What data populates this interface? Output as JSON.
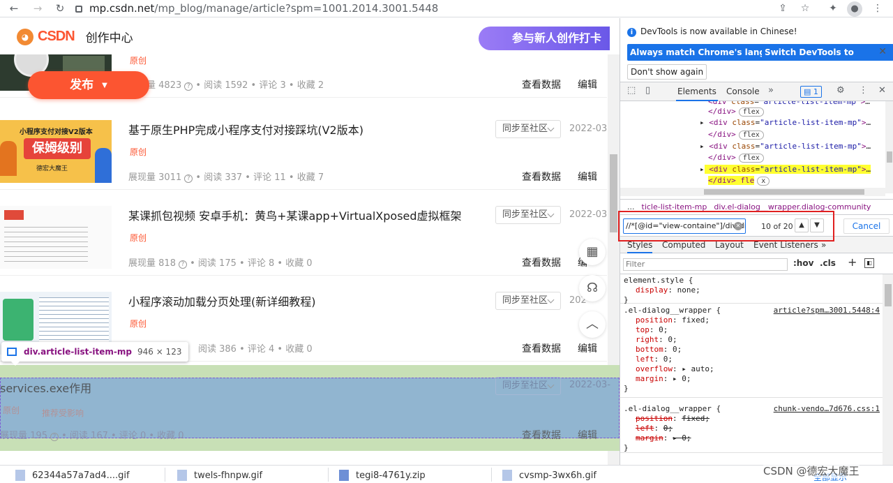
{
  "browser": {
    "url_host": "mp.csdn.net",
    "url_path": "/mp_blog/manage/article?spm=1001.2014.3001.5448"
  },
  "header": {
    "logo_text": "CSDN",
    "subtitle": "创作中心",
    "banner_text": "参与新人创作打卡",
    "publish_label": "发布"
  },
  "articles": [
    {
      "title": "",
      "tag": "原创",
      "impressions_label": "展现量",
      "impressions": "4823",
      "reads": "阅读 1592",
      "comments": "评论 3",
      "favs": "收藏 2",
      "view_data": "查看数据",
      "edit": "编辑"
    },
    {
      "title": "基于原生PHP完成小程序支付对接踩坑(V2版本)",
      "tag": "原创",
      "impressions_label": "展现量",
      "impressions": "3011",
      "reads": "阅读 337",
      "comments": "评论 11",
      "favs": "收藏 7",
      "sync": "同步至社区",
      "date": "2022-03-",
      "view_data": "查看数据",
      "edit": "编辑"
    },
    {
      "title": "某课抓包视频 安卓手机：黄鸟+某课app+VirtualXposed虚拟框架",
      "tag": "原创",
      "impressions_label": "展现量",
      "impressions": "818",
      "reads": "阅读 175",
      "comments": "评论 8",
      "favs": "收藏 0",
      "sync": "同步至社区",
      "date": "2022-03-",
      "view_data": "查看数据",
      "edit": "编"
    },
    {
      "title": "小程序滚动加载分页处理(新详细教程)",
      "tag": "原创",
      "impressions_label": "",
      "impressions": "",
      "reads": "阅读 386",
      "comments": "评论 4",
      "favs": "收藏 0",
      "sync": "同步至社区",
      "date": "202",
      "view_data": "查看数据",
      "edit": "编辑"
    },
    {
      "title": "services.exe作用",
      "tag": "原创",
      "tag2": "推荐受影响",
      "impressions_label": "展现量",
      "impressions": "195",
      "reads": "阅读 167",
      "comments": "评论 0",
      "favs": "收藏 0",
      "sync": "同步至社区",
      "date": "2022-03-",
      "view_data": "查看数据",
      "edit": "编辑"
    }
  ],
  "thumbs": {
    "t1_line1": "小程序支付对接V2版本",
    "t1_line2": "保姆级别",
    "t1_line3": "德宏大魔王"
  },
  "tooltip": {
    "name": "div.article-list-item-mp",
    "dims": "946 × 123"
  },
  "devtools": {
    "info_msg": "DevTools is now available in Chinese!",
    "btn_match": "Always match Chrome's language",
    "btn_switch": "Switch DevTools to Chinese",
    "btn_dont": "Don't show again",
    "tab_elements": "Elements",
    "tab_console": "Console",
    "issues_count": "1",
    "dom_lines": [
      {
        "text": "class=\"article-list-item-mp\">…",
        "kind": "open"
      },
      {
        "text": "</div>",
        "pill": "flex"
      },
      {
        "text": "<div class=\"article-list-item-mp\">…",
        "kind": "open"
      },
      {
        "text": "</div>",
        "pill": "flex"
      },
      {
        "text": "<div class=\"article-list-item-mp\">…",
        "kind": "open"
      },
      {
        "text": "</div>",
        "pill": "flex"
      },
      {
        "text": "<div class=\"article-list-item-mp\">…",
        "kind": "open"
      },
      {
        "text": "</div>",
        "pill": "fle"
      }
    ],
    "crumbs": [
      "...",
      "ticle-list-item-mp",
      "div.el-dialog__wrapper.dialog-community"
    ],
    "search_value": "//*[@id=\"view-containe\"]/div/di",
    "search_count": "10 of 20",
    "cancel": "Cancel",
    "style_tabs": [
      "Styles",
      "Computed",
      "Layout",
      "Event Listeners"
    ],
    "filter_placeholder": "Filter",
    "hov": ":hov",
    "cls": ".cls",
    "rules": [
      {
        "selector": "element.style {",
        "source": "",
        "props": [
          [
            "display",
            "none;"
          ]
        ]
      },
      {
        "selector": ".el-dialog__wrapper {",
        "source": "article?spm…3001.5448:4",
        "props": [
          [
            "position",
            "fixed;"
          ],
          [
            "top",
            "0;"
          ],
          [
            "right",
            "0;"
          ],
          [
            "bottom",
            "0;"
          ],
          [
            "left",
            "0;"
          ],
          [
            "overflow",
            "▸ auto;"
          ],
          [
            "margin",
            "▸ 0;"
          ]
        ]
      },
      {
        "selector": ".el-dialog__wrapper {",
        "source": "chunk-vendo…7d676.css:1",
        "props": [
          [
            "position",
            "fixed;"
          ],
          [
            "left",
            "0;"
          ],
          [
            "margin",
            "▸ 0;"
          ]
        ],
        "struck": true
      }
    ]
  },
  "downloads": [
    {
      "name": "62344a57a7ad4....gif"
    },
    {
      "name": "twels-fhnpw.gif"
    },
    {
      "name": "tegi8-4761y.zip"
    },
    {
      "name": "cvsmp-3wx6h.gif"
    }
  ],
  "downloads_showall": "全部显示",
  "watermark": "CSDN @德宏大魔王"
}
